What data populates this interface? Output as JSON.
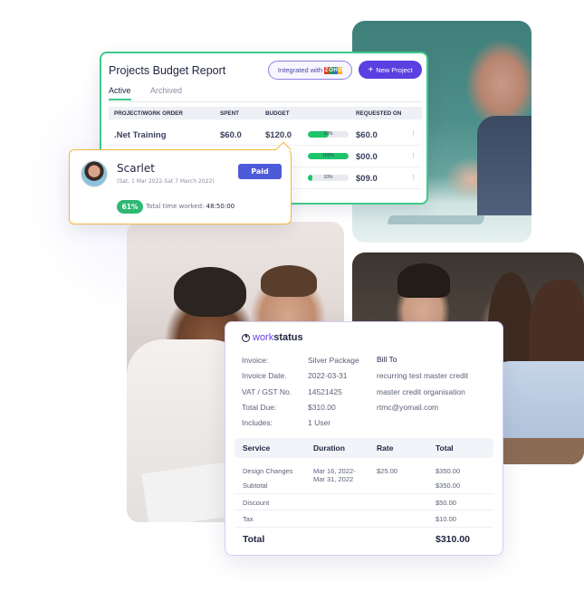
{
  "budget_report": {
    "title": "Projects Budget Report",
    "integrated_label": "Integrated with",
    "integrated_logo": [
      "Z",
      "O",
      "H",
      "O"
    ],
    "new_project_icon": "+",
    "new_project_label": "New Project",
    "tabs": [
      {
        "label": "Active",
        "active": true
      },
      {
        "label": "Archived",
        "active": false
      }
    ],
    "columns": [
      "PROJECT/WORK ORDER",
      "SPENT",
      "BUDGET",
      "REQUESTED ON"
    ],
    "rows": [
      {
        "name": ".Net Training",
        "spent": "$60.0",
        "budget": "$120.0",
        "progress": 50,
        "progress_label": "50%",
        "requested": "$60.0",
        "menu": "⋮"
      },
      {
        "name": "",
        "spent": "",
        "budget": "",
        "progress": 100,
        "progress_label": "100%",
        "requested": "$00.0",
        "menu": "⋮"
      },
      {
        "name": "",
        "spent": "",
        "budget": "",
        "progress": 10,
        "progress_label": "10%",
        "requested": "$09.0",
        "menu": "⋮"
      }
    ]
  },
  "scarlet_popup": {
    "name": "Scarlet",
    "date_range": "(Sat, 1 Mar 2022-Sat 7 March 2022)",
    "status_button": "Paid",
    "percent": "61%",
    "time_label": "Total time worked:",
    "time_value": "48:50:00"
  },
  "invoice": {
    "logo_work": "work",
    "logo_status": "status",
    "fields": [
      {
        "label": "Invoice:",
        "value": "Silver Package"
      },
      {
        "label": "Invoice Date.",
        "value": "2022-03-31"
      },
      {
        "label": "VAT / GST No.",
        "value": "14521425"
      },
      {
        "label": "Total Due:",
        "value": "$310.00"
      },
      {
        "label": "Includes:",
        "value": "1 User"
      }
    ],
    "bill_to": {
      "heading": "Bill To",
      "lines": [
        "recurring test master credit",
        "master credit organisation",
        "rtmc@yomail.com"
      ]
    },
    "columns": [
      "Service",
      "Duration",
      "Rate",
      "Total"
    ],
    "line_item": {
      "service": "Design Changes",
      "duration_start": "Mar 16, 2022-",
      "duration_end": "Mar 31, 2022",
      "rate": "$25.00",
      "total": "$350.00"
    },
    "subtotal": {
      "label": "Subtotal",
      "value": "$350.00"
    },
    "discount": {
      "label": "Discount",
      "value": "$50.00"
    },
    "tax": {
      "label": "Tax",
      "value": "$10.00"
    },
    "grand_total": {
      "label": "Total",
      "value": "$310.00"
    }
  }
}
